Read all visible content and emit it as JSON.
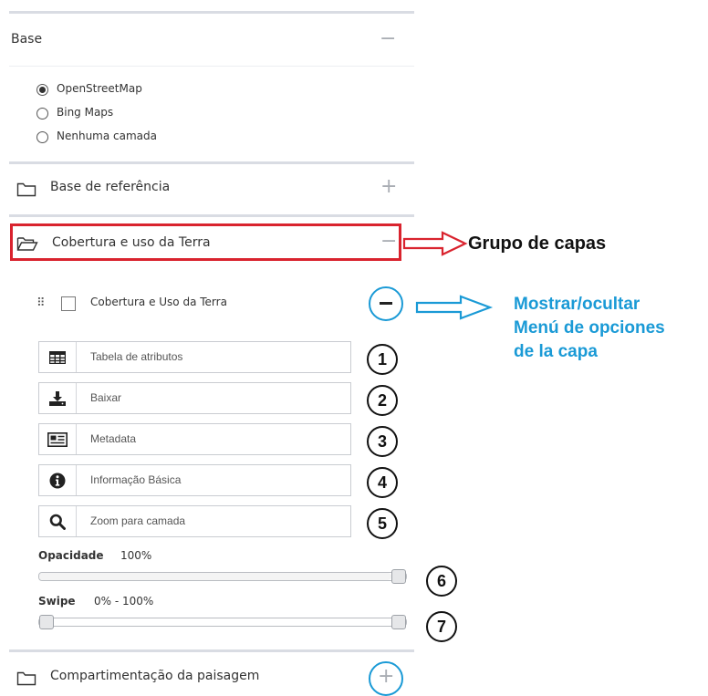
{
  "base": {
    "title": "Base",
    "toggle": "−",
    "options": [
      {
        "label": "OpenStreetMap",
        "selected": true
      },
      {
        "label": "Bing Maps",
        "selected": false
      },
      {
        "label": "Nenhuma camada",
        "selected": false
      }
    ]
  },
  "groups": {
    "referencia": {
      "title": "Base de referência",
      "toggle": "+"
    },
    "cobertura": {
      "title": "Cobertura e uso da Terra",
      "toggle": "−"
    },
    "compartimentacao": {
      "title": "Compartimentação da paisagem",
      "toggle": "+"
    }
  },
  "layer": {
    "title": "Cobertura e Uso da Terra",
    "drag_handle": "⠿",
    "menu_toggle": "−",
    "options": [
      {
        "label": "Tabela de atributos",
        "icon": "table-icon",
        "number": "1"
      },
      {
        "label": "Baixar",
        "icon": "download-icon",
        "number": "2"
      },
      {
        "label": "Metadata",
        "icon": "metadata-card-icon",
        "number": "3"
      },
      {
        "label": "Informação Básica",
        "icon": "info-icon",
        "number": "4"
      },
      {
        "label": "Zoom para camada",
        "icon": "search-icon",
        "number": "5"
      }
    ],
    "opacity": {
      "label": "Opacidade",
      "value_text": "100%",
      "value": 1.0,
      "number": "6"
    },
    "swipe": {
      "label": "Swipe",
      "value_text": "0% - 100%",
      "range": [
        0,
        1
      ],
      "number": "7"
    }
  },
  "annotations": {
    "group": "Grupo de capas",
    "menu_line1": "Mostrar/ocultar",
    "menu_line2": "Menú de opciones",
    "menu_line3": "de la capa",
    "red": "#d9232e",
    "blue": "#1a9ad6"
  }
}
